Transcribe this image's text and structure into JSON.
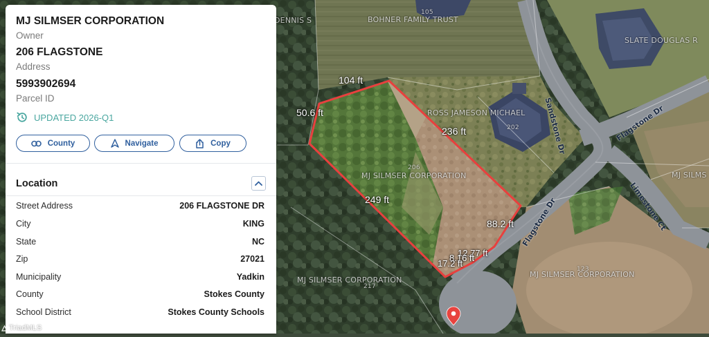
{
  "panel": {
    "owner_name": "MJ SILMSER CORPORATION",
    "owner_label": "Owner",
    "address_value": "206 FLAGSTONE",
    "address_label": "Address",
    "parcel_id_value": "5993902694",
    "parcel_id_label": "Parcel ID",
    "updated_text": "UPDATED 2026-Q1",
    "buttons": {
      "county": "County",
      "navigate": "Navigate",
      "copy": "Copy"
    },
    "location": {
      "title": "Location",
      "rows": [
        {
          "label": "Street Address",
          "value": "206 FLAGSTONE DR"
        },
        {
          "label": "City",
          "value": "KING"
        },
        {
          "label": "State",
          "value": "NC"
        },
        {
          "label": "Zip",
          "value": "27021"
        },
        {
          "label": "Municipality",
          "value": "Yadkin"
        },
        {
          "label": "County",
          "value": "Stokes County"
        },
        {
          "label": "School District",
          "value": "Stokes County Schools"
        }
      ]
    }
  },
  "map": {
    "parcel_labels": {
      "dennis": "DENNIS S",
      "bohner_number": "105",
      "bohner": "BOHNER FAMILY TRUST",
      "slate": "SLATE DOUGLAS R",
      "ross": "ROSS JAMESON MICHAEL",
      "ross_number": "202",
      "subject_number": "206",
      "subject": "MJ SILMSER CORPORATION",
      "mj_east": "MJ SILMS",
      "mj_south_number": "217",
      "mj_south": "MJ SILMSER CORPORATION",
      "mj_se_number": "123",
      "mj_se": "MJ SILMSER CORPORATION"
    },
    "dimensions": {
      "top": "104 ft",
      "left": "50.6 ft",
      "right": "236 ft",
      "bottom": "249 ft",
      "east": "88.2 ft",
      "arc1": "12.77 ft",
      "arc2": "8.16 ft",
      "arc3": "17.2 ft"
    },
    "streets": {
      "sandstone": "Sandstone Dr",
      "flagstone_north": "Flagstone Dr",
      "flagstone_south": "Flagstone Dr",
      "limestone": "Limestone Ct"
    },
    "colors": {
      "parcel_outline": "#e8403e",
      "road": "#8e9399",
      "pin": "#e8433f"
    }
  },
  "watermark": "TriadMLS"
}
